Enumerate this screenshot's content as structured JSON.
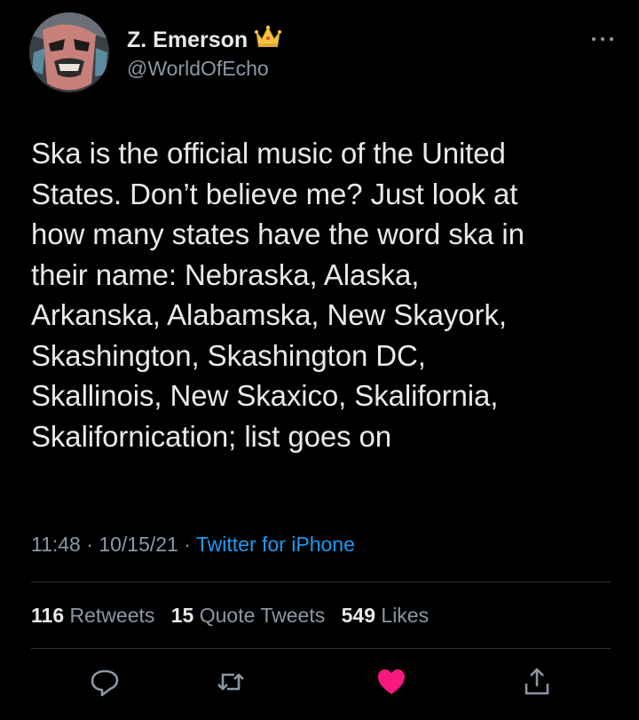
{
  "tweet": {
    "author": {
      "display_name": "Z. Emerson",
      "handle": "@WorldOfEcho",
      "badge_icon": "crown-icon"
    },
    "text": "Ska is the official music of the United\nStates. Don’t believe me? Just look at\nhow many states have the word ska in\ntheir name: Nebraska, Alaska,\nArkanska, Alabamska, New Skayork,\nSkashington, Skashington DC,\nSkallinois, New Skaxico, Skalifornia,\nSkalifornication; list goes on",
    "time": "11:48",
    "date": "10/15/21",
    "separator": "·",
    "source": "Twitter for iPhone",
    "stats": {
      "retweets_count": "116",
      "retweets_label": "Retweets",
      "quote_count": "15",
      "quote_label": "Quote Tweets",
      "likes_count": "549",
      "likes_label": "Likes"
    },
    "actions": [
      "reply-icon",
      "retweet-icon",
      "like-icon",
      "share-icon"
    ],
    "colors": {
      "background": "#000000",
      "text": "#e7e9ea",
      "secondary": "#8b98a5",
      "link": "#1d9bf0",
      "like": "#f91880"
    }
  }
}
